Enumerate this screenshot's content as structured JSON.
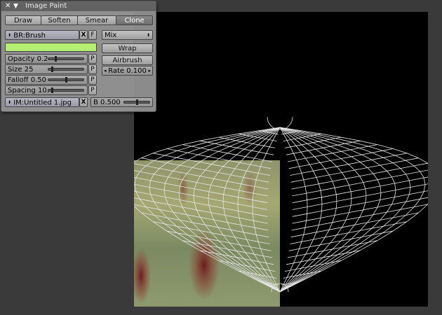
{
  "panel": {
    "title": "Image Paint",
    "close_icon": "x-icon",
    "collapse_icon": "triangle-down-icon",
    "tools": [
      {
        "label": "Draw",
        "active": false
      },
      {
        "label": "Soften",
        "active": false
      },
      {
        "label": "Smear",
        "active": false
      },
      {
        "label": "Clone",
        "active": true
      }
    ],
    "brush": {
      "name": "BR:Brush",
      "clear_label": "X",
      "fake_user_label": "F",
      "color": "#b4ee73"
    },
    "blend_mode": "Mix",
    "sliders": [
      {
        "label": "Opacity 0.2",
        "p": "P",
        "fraction": 0.2
      },
      {
        "label": "Size 25",
        "p": "P",
        "fraction": 0.1
      },
      {
        "label": "Falloff 0.50",
        "p": "P",
        "fraction": 0.5
      },
      {
        "label": "Spacing 10.",
        "p": "P",
        "fraction": 0.1
      }
    ],
    "wrap_label": "Wrap",
    "airbrush_label": "Airbrush",
    "rate_label": "Rate 0.100",
    "image": {
      "name": "IM:Untitled 1.jpg",
      "clear_label": "X"
    },
    "b_slider": {
      "label": "B 0.500",
      "fraction": 0.5
    }
  },
  "colors": {
    "panel_bg": "#969696",
    "header_bg": "#626262",
    "workspace": "#3a3a3a",
    "canvas": "#000000",
    "uv_wire": "#e6e6e6"
  }
}
